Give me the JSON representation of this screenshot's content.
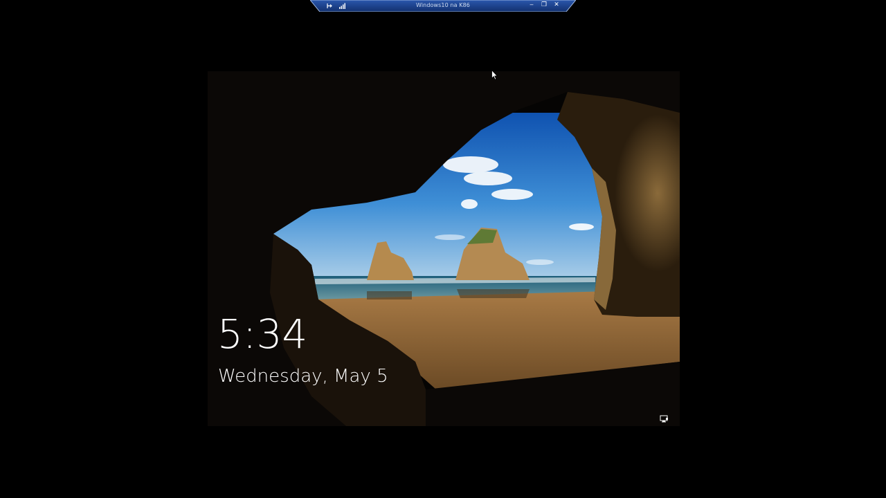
{
  "remote_bar": {
    "title": "Windows10 na K86",
    "pin_icon": "pin-icon",
    "signal_icon": "signal-bars-icon",
    "minimize_glyph": "‒",
    "restore_glyph": "❐",
    "close_glyph": "✕",
    "bar_color": "#1b3f8c"
  },
  "lock_screen": {
    "time": "5:34",
    "date": "Wednesday, May 5",
    "network_icon": "network-monitor-icon"
  },
  "cursor_icon": "mouse-pointer-icon"
}
